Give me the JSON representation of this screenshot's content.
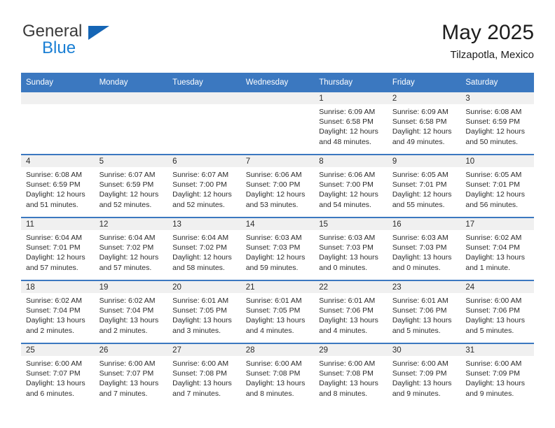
{
  "brand": {
    "name_part1": "General",
    "name_part2": "Blue",
    "colors": {
      "general": "#3a3a3a",
      "blue": "#1a7fd4",
      "triangle": "#1565b5"
    }
  },
  "header": {
    "title": "May 2025",
    "subtitle": "Tilzapotla, Mexico"
  },
  "theme": {
    "header_row_bg": "#3b78c0",
    "header_row_text": "#ffffff",
    "daynum_strip_bg": "#f0f0f0",
    "cell_bg": "#ffffff",
    "row_separator": "#3b78c0",
    "body_text": "#2b2b2b"
  },
  "calendar": {
    "weekdays": [
      "Sunday",
      "Monday",
      "Tuesday",
      "Wednesday",
      "Thursday",
      "Friday",
      "Saturday"
    ],
    "labels": {
      "sunrise": "Sunrise:",
      "sunset": "Sunset:",
      "daylight": "Daylight:"
    },
    "weeks": [
      [
        {
          "day": "",
          "line1": "",
          "line2": "",
          "line3": "",
          "line4": ""
        },
        {
          "day": "",
          "line1": "",
          "line2": "",
          "line3": "",
          "line4": ""
        },
        {
          "day": "",
          "line1": "",
          "line2": "",
          "line3": "",
          "line4": ""
        },
        {
          "day": "",
          "line1": "",
          "line2": "",
          "line3": "",
          "line4": ""
        },
        {
          "day": "1",
          "line1": "Sunrise: 6:09 AM",
          "line2": "Sunset: 6:58 PM",
          "line3": "Daylight: 12 hours",
          "line4": "and 48 minutes."
        },
        {
          "day": "2",
          "line1": "Sunrise: 6:09 AM",
          "line2": "Sunset: 6:58 PM",
          "line3": "Daylight: 12 hours",
          "line4": "and 49 minutes."
        },
        {
          "day": "3",
          "line1": "Sunrise: 6:08 AM",
          "line2": "Sunset: 6:59 PM",
          "line3": "Daylight: 12 hours",
          "line4": "and 50 minutes."
        }
      ],
      [
        {
          "day": "4",
          "line1": "Sunrise: 6:08 AM",
          "line2": "Sunset: 6:59 PM",
          "line3": "Daylight: 12 hours",
          "line4": "and 51 minutes."
        },
        {
          "day": "5",
          "line1": "Sunrise: 6:07 AM",
          "line2": "Sunset: 6:59 PM",
          "line3": "Daylight: 12 hours",
          "line4": "and 52 minutes."
        },
        {
          "day": "6",
          "line1": "Sunrise: 6:07 AM",
          "line2": "Sunset: 7:00 PM",
          "line3": "Daylight: 12 hours",
          "line4": "and 52 minutes."
        },
        {
          "day": "7",
          "line1": "Sunrise: 6:06 AM",
          "line2": "Sunset: 7:00 PM",
          "line3": "Daylight: 12 hours",
          "line4": "and 53 minutes."
        },
        {
          "day": "8",
          "line1": "Sunrise: 6:06 AM",
          "line2": "Sunset: 7:00 PM",
          "line3": "Daylight: 12 hours",
          "line4": "and 54 minutes."
        },
        {
          "day": "9",
          "line1": "Sunrise: 6:05 AM",
          "line2": "Sunset: 7:01 PM",
          "line3": "Daylight: 12 hours",
          "line4": "and 55 minutes."
        },
        {
          "day": "10",
          "line1": "Sunrise: 6:05 AM",
          "line2": "Sunset: 7:01 PM",
          "line3": "Daylight: 12 hours",
          "line4": "and 56 minutes."
        }
      ],
      [
        {
          "day": "11",
          "line1": "Sunrise: 6:04 AM",
          "line2": "Sunset: 7:01 PM",
          "line3": "Daylight: 12 hours",
          "line4": "and 57 minutes."
        },
        {
          "day": "12",
          "line1": "Sunrise: 6:04 AM",
          "line2": "Sunset: 7:02 PM",
          "line3": "Daylight: 12 hours",
          "line4": "and 57 minutes."
        },
        {
          "day": "13",
          "line1": "Sunrise: 6:04 AM",
          "line2": "Sunset: 7:02 PM",
          "line3": "Daylight: 12 hours",
          "line4": "and 58 minutes."
        },
        {
          "day": "14",
          "line1": "Sunrise: 6:03 AM",
          "line2": "Sunset: 7:03 PM",
          "line3": "Daylight: 12 hours",
          "line4": "and 59 minutes."
        },
        {
          "day": "15",
          "line1": "Sunrise: 6:03 AM",
          "line2": "Sunset: 7:03 PM",
          "line3": "Daylight: 13 hours",
          "line4": "and 0 minutes."
        },
        {
          "day": "16",
          "line1": "Sunrise: 6:03 AM",
          "line2": "Sunset: 7:03 PM",
          "line3": "Daylight: 13 hours",
          "line4": "and 0 minutes."
        },
        {
          "day": "17",
          "line1": "Sunrise: 6:02 AM",
          "line2": "Sunset: 7:04 PM",
          "line3": "Daylight: 13 hours",
          "line4": "and 1 minute."
        }
      ],
      [
        {
          "day": "18",
          "line1": "Sunrise: 6:02 AM",
          "line2": "Sunset: 7:04 PM",
          "line3": "Daylight: 13 hours",
          "line4": "and 2 minutes."
        },
        {
          "day": "19",
          "line1": "Sunrise: 6:02 AM",
          "line2": "Sunset: 7:04 PM",
          "line3": "Daylight: 13 hours",
          "line4": "and 2 minutes."
        },
        {
          "day": "20",
          "line1": "Sunrise: 6:01 AM",
          "line2": "Sunset: 7:05 PM",
          "line3": "Daylight: 13 hours",
          "line4": "and 3 minutes."
        },
        {
          "day": "21",
          "line1": "Sunrise: 6:01 AM",
          "line2": "Sunset: 7:05 PM",
          "line3": "Daylight: 13 hours",
          "line4": "and 4 minutes."
        },
        {
          "day": "22",
          "line1": "Sunrise: 6:01 AM",
          "line2": "Sunset: 7:06 PM",
          "line3": "Daylight: 13 hours",
          "line4": "and 4 minutes."
        },
        {
          "day": "23",
          "line1": "Sunrise: 6:01 AM",
          "line2": "Sunset: 7:06 PM",
          "line3": "Daylight: 13 hours",
          "line4": "and 5 minutes."
        },
        {
          "day": "24",
          "line1": "Sunrise: 6:00 AM",
          "line2": "Sunset: 7:06 PM",
          "line3": "Daylight: 13 hours",
          "line4": "and 5 minutes."
        }
      ],
      [
        {
          "day": "25",
          "line1": "Sunrise: 6:00 AM",
          "line2": "Sunset: 7:07 PM",
          "line3": "Daylight: 13 hours",
          "line4": "and 6 minutes."
        },
        {
          "day": "26",
          "line1": "Sunrise: 6:00 AM",
          "line2": "Sunset: 7:07 PM",
          "line3": "Daylight: 13 hours",
          "line4": "and 7 minutes."
        },
        {
          "day": "27",
          "line1": "Sunrise: 6:00 AM",
          "line2": "Sunset: 7:08 PM",
          "line3": "Daylight: 13 hours",
          "line4": "and 7 minutes."
        },
        {
          "day": "28",
          "line1": "Sunrise: 6:00 AM",
          "line2": "Sunset: 7:08 PM",
          "line3": "Daylight: 13 hours",
          "line4": "and 8 minutes."
        },
        {
          "day": "29",
          "line1": "Sunrise: 6:00 AM",
          "line2": "Sunset: 7:08 PM",
          "line3": "Daylight: 13 hours",
          "line4": "and 8 minutes."
        },
        {
          "day": "30",
          "line1": "Sunrise: 6:00 AM",
          "line2": "Sunset: 7:09 PM",
          "line3": "Daylight: 13 hours",
          "line4": "and 9 minutes."
        },
        {
          "day": "31",
          "line1": "Sunrise: 6:00 AM",
          "line2": "Sunset: 7:09 PM",
          "line3": "Daylight: 13 hours",
          "line4": "and 9 minutes."
        }
      ]
    ]
  }
}
